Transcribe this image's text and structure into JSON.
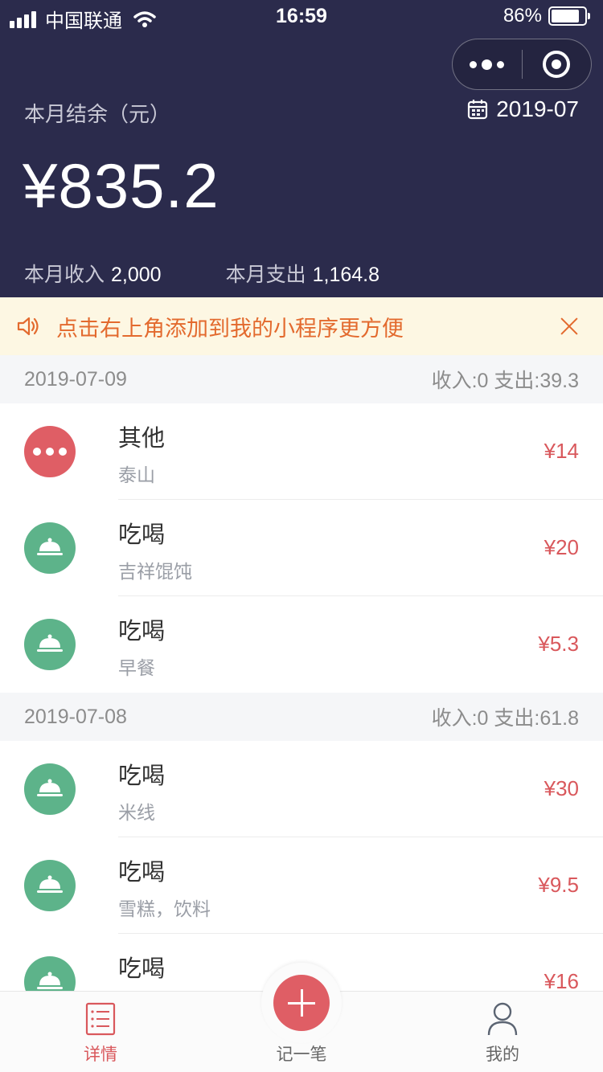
{
  "status_bar": {
    "carrier": "中国联通",
    "time": "16:59",
    "battery_percent": "86%",
    "battery_level": 0.86
  },
  "header": {
    "balance_label": "本月结余（元）",
    "month": "2019-07",
    "balance": "¥835.2",
    "income_label": "本月收入",
    "income_value": "2,000",
    "expense_label": "本月支出",
    "expense_value": "1,164.8"
  },
  "notice": {
    "text": "点击右上角添加到我的小程序更方便"
  },
  "days": [
    {
      "date": "2019-07-09",
      "summary": "收入:0 支出:39.3",
      "items": [
        {
          "category": "其他",
          "note": "泰山",
          "amount": "¥14",
          "icon": "more-dots-icon"
        },
        {
          "category": "吃喝",
          "note": "吉祥馄饨",
          "amount": "¥20",
          "icon": "food-cloche-icon"
        },
        {
          "category": "吃喝",
          "note": "早餐",
          "amount": "¥5.3",
          "icon": "food-cloche-icon"
        }
      ]
    },
    {
      "date": "2019-07-08",
      "summary": "收入:0 支出:61.8",
      "items": [
        {
          "category": "吃喝",
          "note": "米线",
          "amount": "¥30",
          "icon": "food-cloche-icon"
        },
        {
          "category": "吃喝",
          "note": "雪糕，饮料",
          "amount": "¥9.5",
          "icon": "food-cloche-icon"
        },
        {
          "category": "吃喝",
          "note": "",
          "amount": "¥16",
          "icon": "food-cloche-icon"
        }
      ]
    }
  ],
  "tabs": {
    "details": "详情",
    "add": "记一笔",
    "mine": "我的"
  },
  "colors": {
    "header_bg": "#2b2b4c",
    "accent_red": "#df5e65",
    "food_green": "#5db38a",
    "notice_orange": "#e36a2e",
    "notice_bg": "#fdf7e3"
  }
}
